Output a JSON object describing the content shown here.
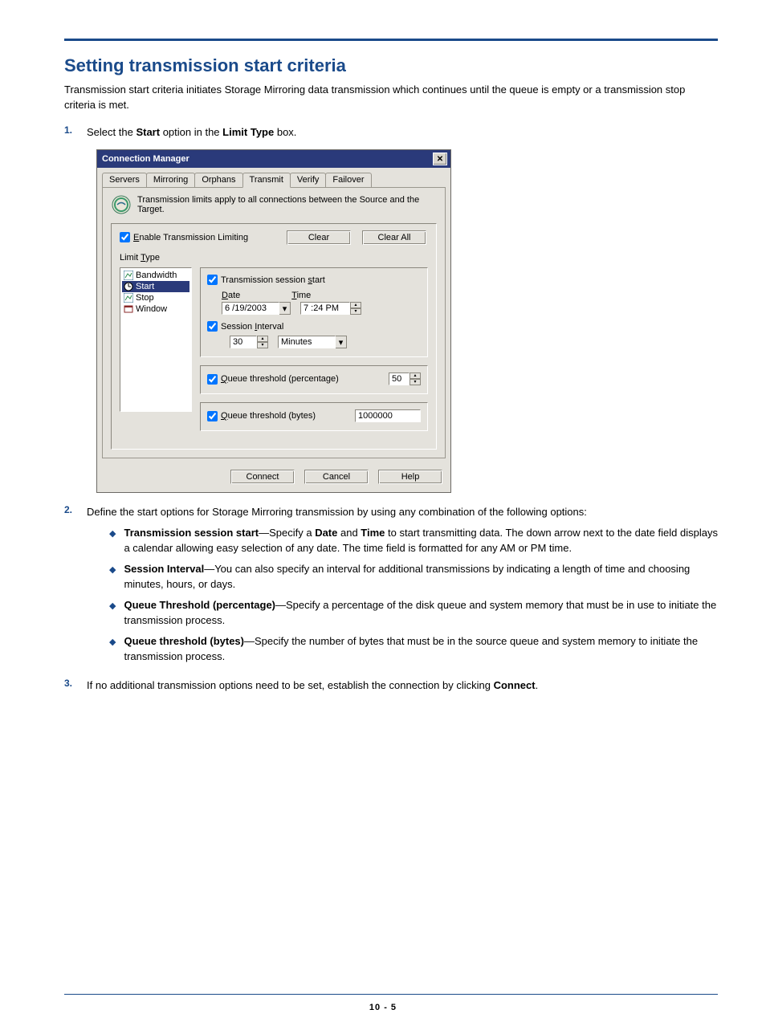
{
  "heading": "Setting transmission start criteria",
  "intro": "Transmission start criteria initiates Storage Mirroring data transmission which continues until the queue is empty or a transmission stop criteria is met.",
  "steps": [
    {
      "num": "1.",
      "pre": "Select the",
      "b1": "Start",
      "mid": "option in the",
      "b2": "Limit Type",
      "post": "box."
    },
    {
      "num": "2.",
      "text": "Define the start options for Storage Mirroring transmission by using any combination of the following options:"
    },
    {
      "num": "3.",
      "pre": "If no additional transmission options need to be set, establish the connection by clicking ",
      "b1": "Connect",
      "post": "."
    }
  ],
  "dialog": {
    "title": "Connection Manager",
    "tabs": [
      "Servers",
      "Mirroring",
      "Orphans",
      "Transmit",
      "Verify",
      "Failover"
    ],
    "note": "Transmission limits apply to all connections between the Source and the Target.",
    "enable_u": "E",
    "enable_rest": "nable Transmission Limiting",
    "limit_pre": "Limit ",
    "limit_u": "T",
    "limit_post": "ype",
    "clear": "Clear",
    "clear_all": "Clear All",
    "list": [
      "Bandwidth",
      "Start",
      "Stop",
      "Window"
    ],
    "sess": {
      "pre": "Transmission session ",
      "u": "s",
      "post": "tart"
    },
    "date_u": "D",
    "date_rest": "ate",
    "time_u": "T",
    "time_rest": "ime",
    "date_val": "6 /19/2003",
    "time_val": "7 :24 PM",
    "int": {
      "pre": "Session ",
      "u": "I",
      "post": "nterval"
    },
    "int_val": "30",
    "int_unit": "Minutes",
    "qp_u": "Q",
    "qp_rest": "ueue threshold (percentage)",
    "qp_val": "50",
    "qb_u": "Q",
    "qb_rest": "ueue threshold (bytes)",
    "qb_val": "1000000",
    "connect": "Connect",
    "cancel": "Cancel",
    "help": "Help"
  },
  "bullets": [
    {
      "b": "Transmission session start",
      "t1": "—Specify a ",
      "b2": "Date",
      "t2": " and ",
      "b3": "Time",
      "t3": " to start transmitting data. The down arrow next to the date field displays a calendar allowing easy selection of any date. The time field is formatted for any AM or PM time."
    },
    {
      "b": "Session Interval",
      "t1": "—You can also specify an interval for additional transmissions by indicating a length of time and choosing minutes, hours, or days."
    },
    {
      "b": "Queue Threshold (percentage)",
      "t1": "—Specify a percentage of the disk queue and system memory that must be in use to initiate the transmission process."
    },
    {
      "b": "Queue threshold (bytes)",
      "t1": "—Specify the number of bytes that must be in the source queue and system memory to initiate the transmission process."
    }
  ],
  "page_number": "10 - 5"
}
